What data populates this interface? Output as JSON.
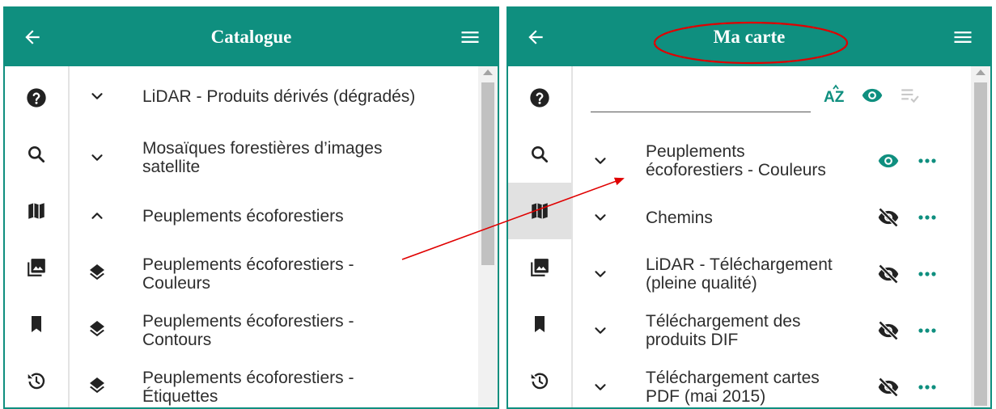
{
  "colors": {
    "accent": "#0f8f7f",
    "annotation": "#e00000"
  },
  "catalog_panel": {
    "header": {
      "title": "Catalogue",
      "back_icon": "arrow-left-icon",
      "menu_icon": "hamburger-menu-icon"
    },
    "sidebar": [
      {
        "icon": "help-circle-icon",
        "active": false
      },
      {
        "icon": "search-icon",
        "active": false
      },
      {
        "icon": "map-icon",
        "active": false
      },
      {
        "icon": "image-gallery-icon",
        "active": false
      },
      {
        "icon": "bookmark-icon",
        "active": false
      },
      {
        "icon": "history-icon",
        "active": false
      }
    ],
    "items": [
      {
        "icon": "chevron-down-icon",
        "label": "LiDAR - Produits dérivés (dégradés)"
      },
      {
        "icon": "chevron-down-icon",
        "label": "Mosaïques forestières d’images satellite"
      },
      {
        "icon": "chevron-up-icon",
        "label": "Peuplements écoforestiers"
      },
      {
        "icon": "layers-icon",
        "label": "Peuplements écoforestiers - Couleurs"
      },
      {
        "icon": "layers-icon",
        "label": "Peuplements écoforestiers - Contours"
      },
      {
        "icon": "layers-icon",
        "label": "Peuplements écoforestiers - Étiquettes"
      }
    ]
  },
  "map_panel": {
    "header": {
      "title": "Ma carte",
      "back_icon": "arrow-left-icon",
      "menu_icon": "hamburger-menu-icon"
    },
    "sidebar": [
      {
        "icon": "help-circle-icon",
        "active": false
      },
      {
        "icon": "search-icon",
        "active": false
      },
      {
        "icon": "map-icon",
        "active": true
      },
      {
        "icon": "image-gallery-icon",
        "active": false
      },
      {
        "icon": "bookmark-icon",
        "active": false
      },
      {
        "icon": "history-icon",
        "active": false
      }
    ],
    "toolbar": {
      "filter_placeholder": "",
      "filter_value": "",
      "sort_label": "AZ",
      "sort_icon": "sort-alpha-icon",
      "visibility_icon": "eye-icon",
      "select_icon": "playlist-check-icon"
    },
    "layers": [
      {
        "label": "Peuplements écoforestiers - Couleurs",
        "visible": true
      },
      {
        "label": "Chemins",
        "visible": false
      },
      {
        "label": "LiDAR - Téléchargement (pleine qualité)",
        "visible": false
      },
      {
        "label": "Téléchargement des produits DIF",
        "visible": false
      },
      {
        "label": "Téléchargement cartes PDF (mai 2015)",
        "visible": false
      }
    ]
  }
}
